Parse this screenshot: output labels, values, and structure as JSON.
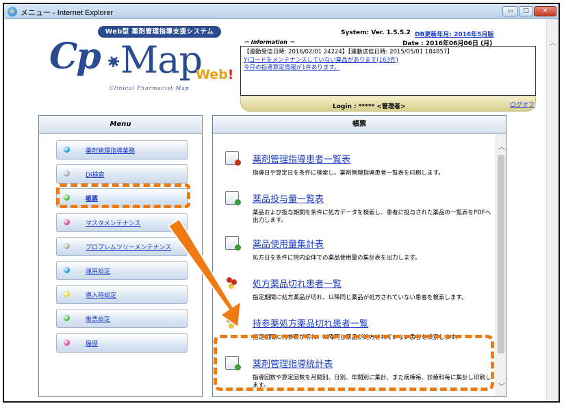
{
  "window": {
    "title": "メニュー - Internet Explorer",
    "minimize": "▭",
    "maximize": "□",
    "close": "✕"
  },
  "logo": {
    "banner": "Web型 薬剤管理指導支援システム",
    "cp": "Cp",
    "map": "Map",
    "web": "Web",
    "exclaim": "!",
    "subtitle": "Clinical Pharmacist-Map"
  },
  "header": {
    "system_version": "System: Ver. 1.5.5.2",
    "db_update": "DB更新年月: 2016年5月版",
    "information_label": "－ Information －",
    "date_label": "Date : 2016年06月06日 (月)",
    "info_line1": "【連動受信日時: 2016/02/01 24224】【連動送信日時: 2015/05/01 184857】",
    "info_link1": "YJコードをメンテナンスしていない薬品があります(163件)",
    "info_link2": "今月の指導算定情報が1件あります。",
    "login": "Login : ***** <管理者>",
    "logout": "ログオフ"
  },
  "menu": {
    "header": "Menu",
    "items": [
      {
        "label": "薬剤管理指導業務",
        "color": "#1e9be0"
      },
      {
        "label": "DI検索",
        "color": "#a8a8a8"
      },
      {
        "label": "帳票",
        "color": "#3cba3c"
      },
      {
        "label": "マスタメンテナンス",
        "color": "#e0448c"
      },
      {
        "label": "プロブレムツリーメンテナンス",
        "color": "#a8a8a8"
      },
      {
        "label": "運用設定",
        "color": "#1e9be0"
      },
      {
        "label": "導入時設定",
        "color": "#e8d030"
      },
      {
        "label": "帳票設定",
        "color": "#3cba3c"
      },
      {
        "label": "履歴",
        "color": "#e0448c"
      }
    ]
  },
  "report": {
    "header": "帳票",
    "items": [
      {
        "title": "薬剤管理指導患者一覧表",
        "desc": "指導日や算定日を条件に検索し、薬剤管理指導患者一覧表を印刷します。"
      },
      {
        "title": "薬品投与量一覧表",
        "desc": "薬品および投与期間を条件に処方データを検索し、患者に投与された薬品の一覧表をPDFへ出力します。"
      },
      {
        "title": "薬品使用量集計表",
        "desc": "処方日を条件に院内全体での薬品使用量の集計表を出力します。"
      },
      {
        "title": "処方薬品切れ患者一覧",
        "desc": "指定期間に処方薬品が切れ、以降同じ薬品が処方されていない患者を検索します。"
      },
      {
        "title": "持参薬処方薬品切れ患者一覧",
        "desc": "指定期間に持参薬が切れ、以降同じ薬品が処方されていない患者を検索します。"
      },
      {
        "title": "薬剤管理指導統計表",
        "desc": "指導回数や算定回数を月間別、日別、年間別に集計、また病棟毎、診療科毎に集計し印刷します。"
      }
    ]
  },
  "colors": {
    "accent_orange": "#f07a12",
    "link_blue": "#1a3cc8",
    "brand_navy": "#2a4b90"
  }
}
